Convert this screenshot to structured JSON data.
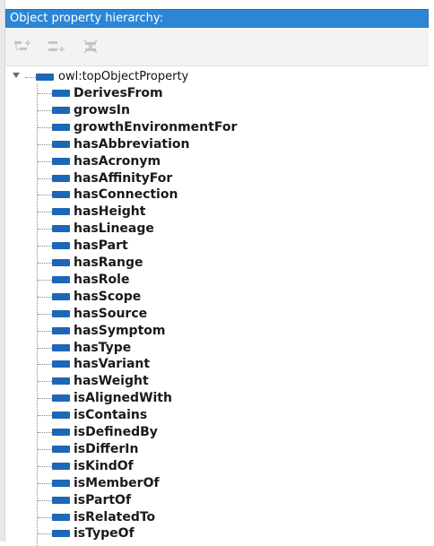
{
  "panel": {
    "title": "Object property hierarchy:"
  },
  "toolbar": {
    "buttons": [
      {
        "name": "add-subproperty-button",
        "icon": "add-sub-property-icon"
      },
      {
        "name": "add-sibling-property-button",
        "icon": "add-sibling-property-icon"
      },
      {
        "name": "delete-property-button",
        "icon": "delete-property-icon"
      }
    ]
  },
  "tree": {
    "root": {
      "label": "owl:topObjectProperty",
      "expanded": true
    },
    "items": [
      "DerivesFrom",
      "growsIn",
      "growthEnvironmentFor",
      "hasAbbreviation",
      "hasAcronym",
      "hasAffinityFor",
      "hasConnection",
      "hasHeight",
      "hasLineage",
      "hasPart",
      "hasRange",
      "hasRole",
      "hasScope",
      "hasSource",
      "hasSymptom",
      "hasType",
      "hasVariant",
      "hasWeight",
      "isAlignedWith",
      "isContains",
      "isDefinedBy",
      "isDifferIn",
      "isKindOf",
      "isMemberOf",
      "isPartOf",
      "isRelatedTo",
      "isTypeOf"
    ]
  },
  "colors": {
    "title_bg": "#2c86d6",
    "property_icon": "#1e66b8"
  }
}
